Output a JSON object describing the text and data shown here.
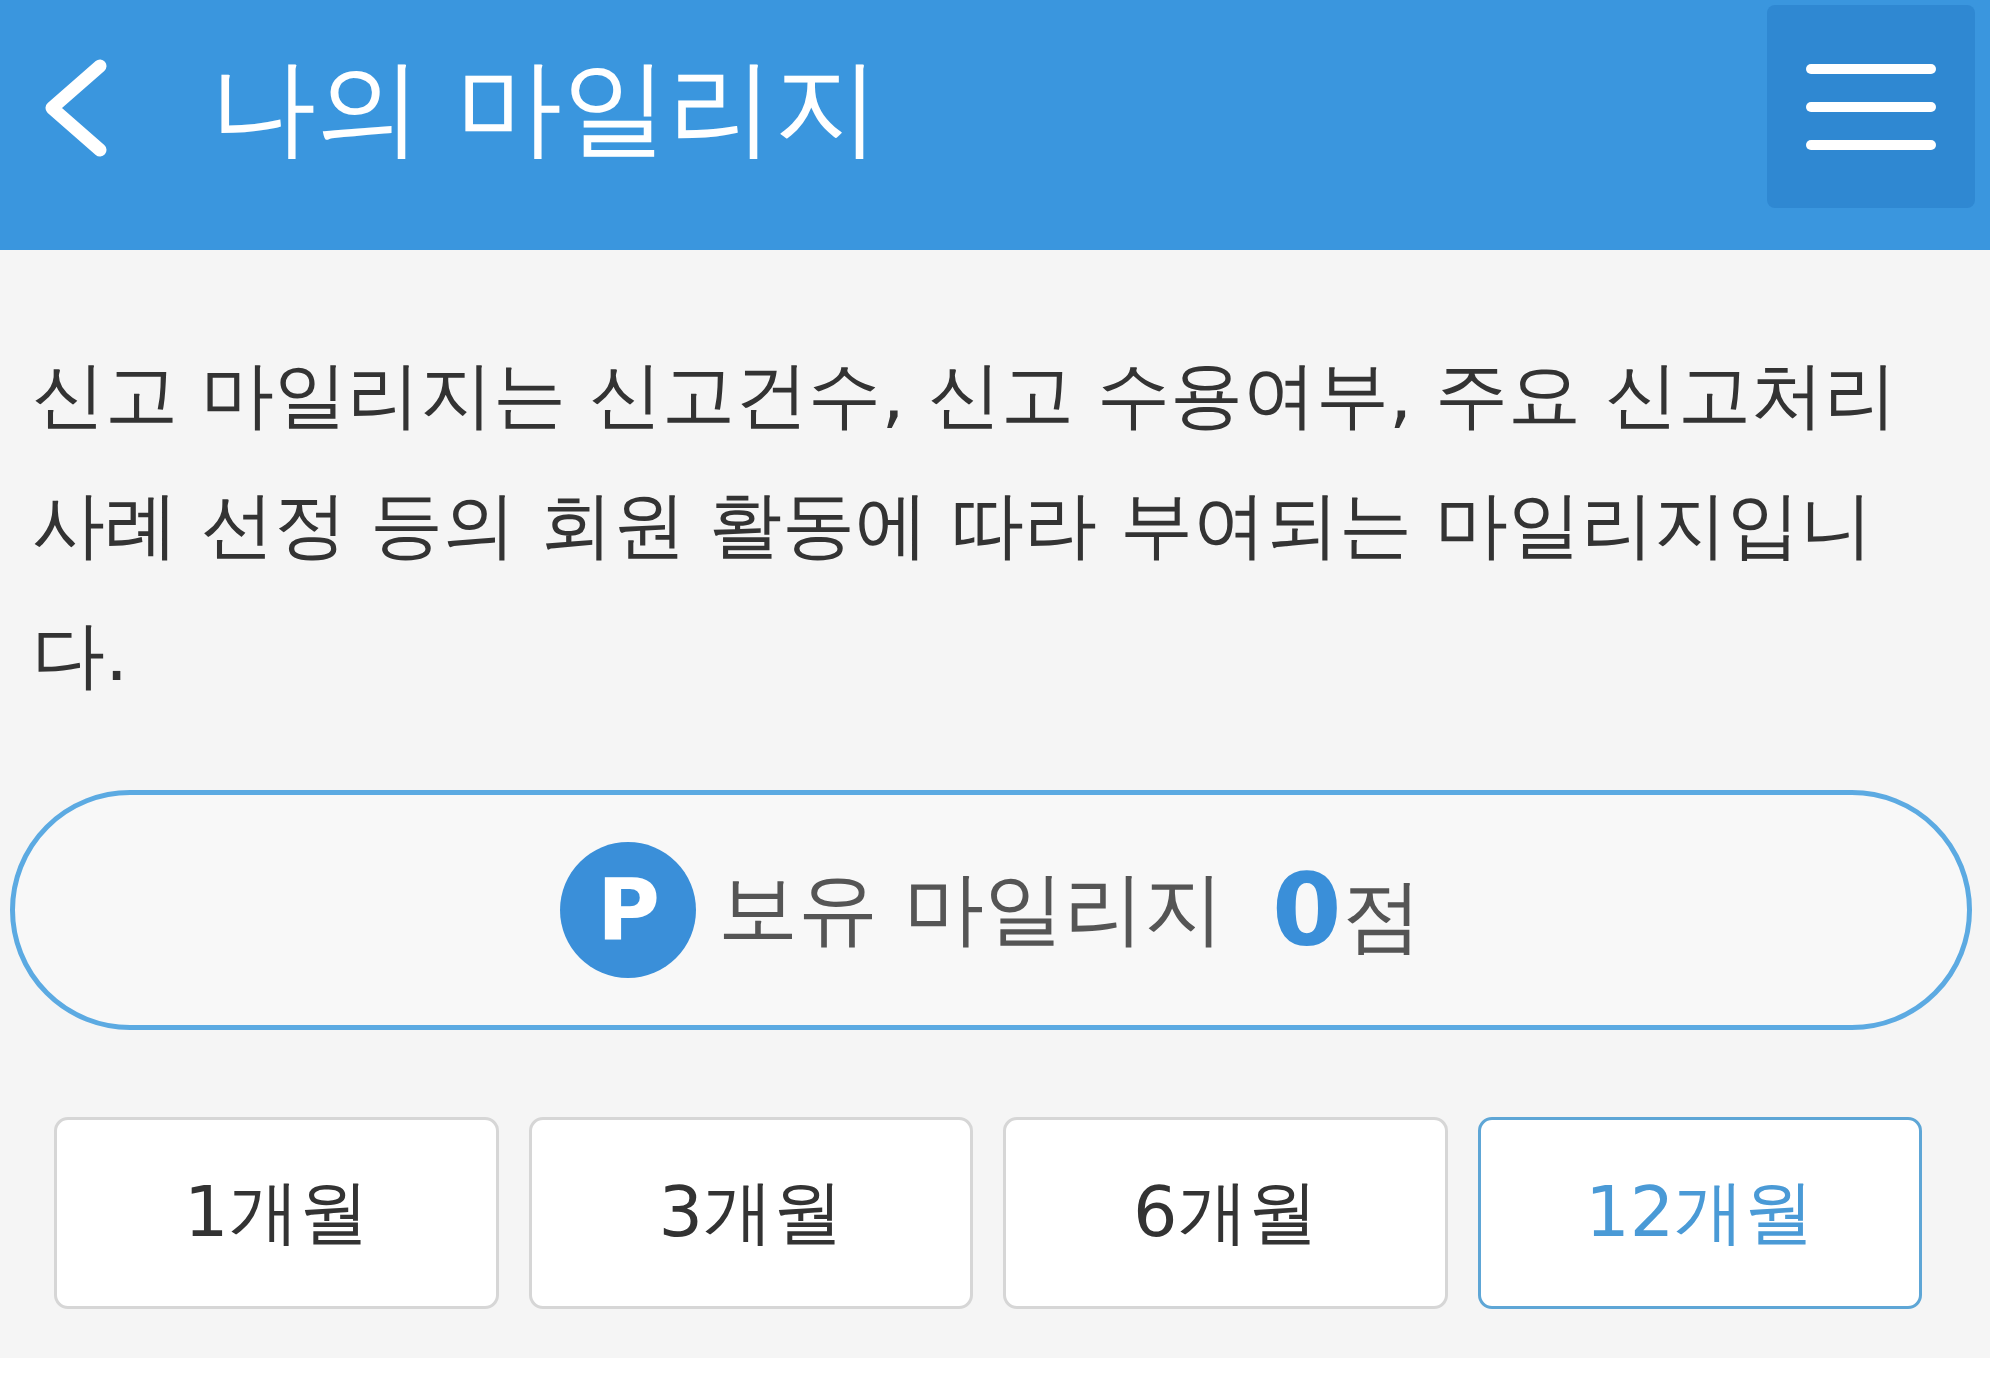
{
  "header": {
    "title": "나의 마일리지"
  },
  "description": "신고 마일리지는 신고건수, 신고 수용여부, 주요 신고처리 사례 선정 등의 회원 활동에 따라 부여되는 마일리지입니다.",
  "balance": {
    "badge": "P",
    "label": "보유 마일리지",
    "value": "0",
    "unit": "점"
  },
  "periods": [
    {
      "label": "1개월",
      "selected": false
    },
    {
      "label": "3개월",
      "selected": false
    },
    {
      "label": "6개월",
      "selected": false
    },
    {
      "label": "12개월",
      "selected": true
    }
  ]
}
